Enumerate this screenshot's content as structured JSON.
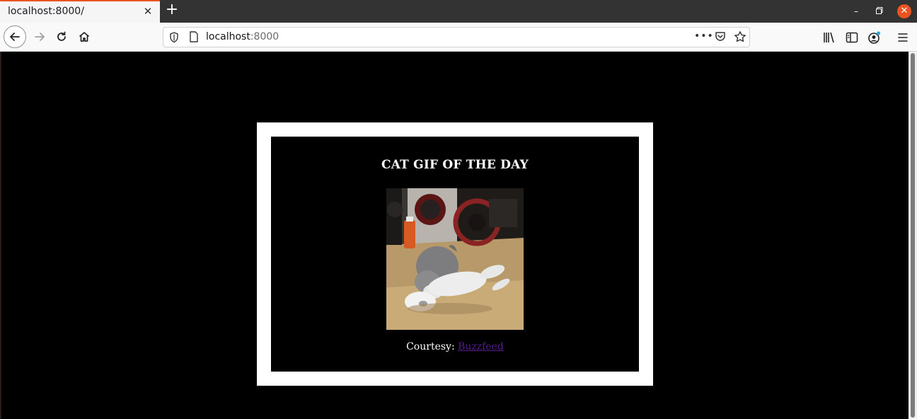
{
  "browser": {
    "tab_title": "localhost:8000/",
    "url_host": "localhost",
    "url_port": ":8000"
  },
  "page": {
    "title": "CAT GIF OF THE DAY",
    "courtesy_label": "Courtesy: ",
    "courtesy_link": "Buzzfeed",
    "image_alt": "Cat gif"
  },
  "colors": {
    "accent": "#e95420",
    "link": "#551a8b",
    "page_bg": "#000000",
    "card_frame": "#ffffff"
  },
  "icons": [
    "close-icon",
    "plus-icon",
    "minimize-icon",
    "restore-icon",
    "window-close-icon",
    "back-arrow-icon",
    "forward-arrow-icon",
    "reload-icon",
    "home-icon",
    "shield-icon",
    "page-icon",
    "more-icon",
    "pocket-icon",
    "star-icon",
    "library-icon",
    "sidebar-icon",
    "account-icon",
    "menu-icon"
  ]
}
